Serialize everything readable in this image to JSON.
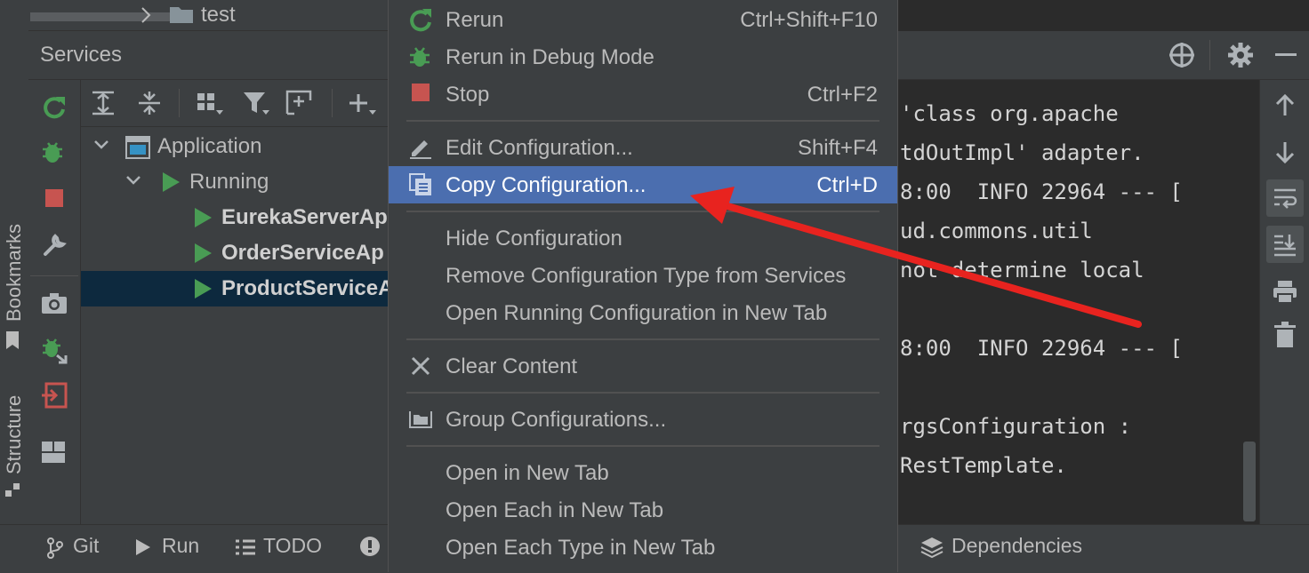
{
  "breadcrumb": {
    "folder_label": "test"
  },
  "services": {
    "title": "Services"
  },
  "side_labels": {
    "bookmarks": "Bookmarks",
    "structure": "Structure"
  },
  "tree": {
    "root": "Application",
    "group": "Running",
    "items": [
      "EurekaServerAp",
      "OrderServiceAp",
      "ProductServiceA"
    ]
  },
  "menu": {
    "items": [
      {
        "label": "Rerun",
        "shortcut": "Ctrl+Shift+F10",
        "icon": "rerun-icon"
      },
      {
        "label": "Rerun in Debug Mode",
        "shortcut": "",
        "icon": "debug-rerun-icon"
      },
      {
        "label": "Stop",
        "shortcut": "Ctrl+F2",
        "icon": "stop-icon"
      },
      {
        "label": "Edit Configuration...",
        "shortcut": "Shift+F4",
        "icon": "edit-icon"
      },
      {
        "label": "Copy Configuration...",
        "shortcut": "Ctrl+D",
        "icon": "copy-icon",
        "selected": true
      },
      {
        "label": "Hide Configuration",
        "shortcut": ""
      },
      {
        "label": "Remove Configuration Type from Services",
        "shortcut": ""
      },
      {
        "label": "Open Running Configuration in New Tab",
        "shortcut": ""
      },
      {
        "label": "Clear Content",
        "shortcut": "",
        "icon": "clear-icon"
      },
      {
        "label": "Group Configurations...",
        "shortcut": "",
        "icon": "group-icon"
      },
      {
        "label": "Open in New Tab",
        "shortcut": ""
      },
      {
        "label": "Open Each in New Tab",
        "shortcut": ""
      },
      {
        "label": "Open Each Type in New Tab",
        "shortcut": ""
      }
    ]
  },
  "console": {
    "lines": [
      "'class org.apache",
      "tdOutImpl' adapter.",
      "8:00  INFO 22964 --- [",
      "ud.commons.util",
      "not determine local",
      "8:00  INFO 22964 --- [",
      "rgsConfiguration :",
      "RestTemplate."
    ]
  },
  "bottom_bar": {
    "git": "Git",
    "run": "Run",
    "todo": "TODO",
    "dependencies": "Dependencies"
  },
  "colors": {
    "menu_selection": "#4b6eaf",
    "run_green": "#499c54",
    "stop_red": "#c75450",
    "annotation_arrow": "#e8231f"
  }
}
